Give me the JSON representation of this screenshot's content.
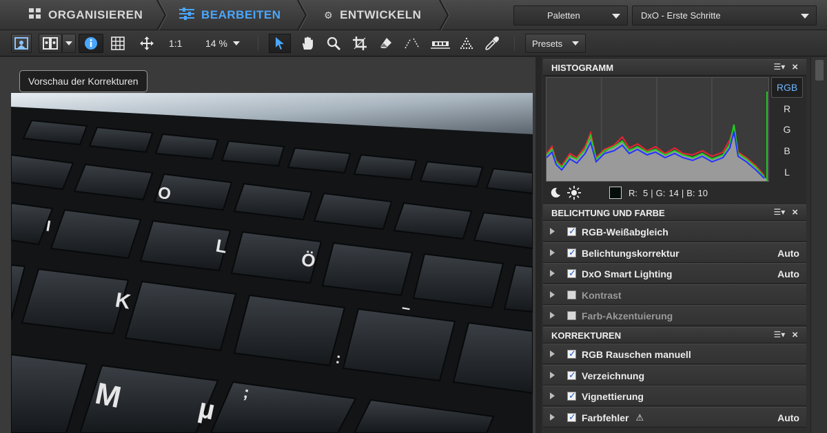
{
  "nav": {
    "tabs": [
      {
        "label": "ORGANISIEREN",
        "icon": "grid-icon"
      },
      {
        "label": "BEARBEITEN",
        "icon": "sliders-icon",
        "active": true
      },
      {
        "label": "ENTWICKELN",
        "icon": "gears-icon"
      }
    ],
    "palettes_label": "Paletten",
    "workspace_label": "DxO - Erste Schritte"
  },
  "toolbar": {
    "zoom_1to1": "1:1",
    "zoom_level": "14 %",
    "presets_label": "Presets"
  },
  "viewer": {
    "tooltip": "Vorschau der Korrekturen"
  },
  "histogram": {
    "title": "HISTOGRAMM",
    "channels": [
      "RGB",
      "R",
      "G",
      "B",
      "L"
    ],
    "selected_channel": "RGB",
    "readout": {
      "r_label": "R:",
      "r": "5",
      "g_label": "G:",
      "g": "14",
      "b_label": "B:",
      "b": "10"
    }
  },
  "exposure_panel": {
    "title": "BELICHTUNG UND FARBE",
    "items": [
      {
        "label": "RGB-Weißabgleich",
        "checked": true,
        "value": ""
      },
      {
        "label": "Belichtungskorrektur",
        "checked": true,
        "value": "Auto"
      },
      {
        "label": "DxO Smart Lighting",
        "checked": true,
        "value": "Auto"
      },
      {
        "label": "Kontrast",
        "checked": false,
        "value": ""
      },
      {
        "label": "Farb-Akzentuierung",
        "checked": false,
        "value": ""
      }
    ]
  },
  "corrections_panel": {
    "title": "KORREKTUREN",
    "items": [
      {
        "label": "RGB Rauschen manuell",
        "checked": true,
        "value": ""
      },
      {
        "label": "Verzeichnung",
        "checked": true,
        "value": ""
      },
      {
        "label": "Vignettierung",
        "checked": true,
        "value": ""
      },
      {
        "label": "Farbfehler",
        "checked": true,
        "value": "Auto",
        "warning": true
      }
    ]
  },
  "colors": {
    "accent": "#4aa7ff",
    "panel_bg": "#2e2e2e"
  }
}
